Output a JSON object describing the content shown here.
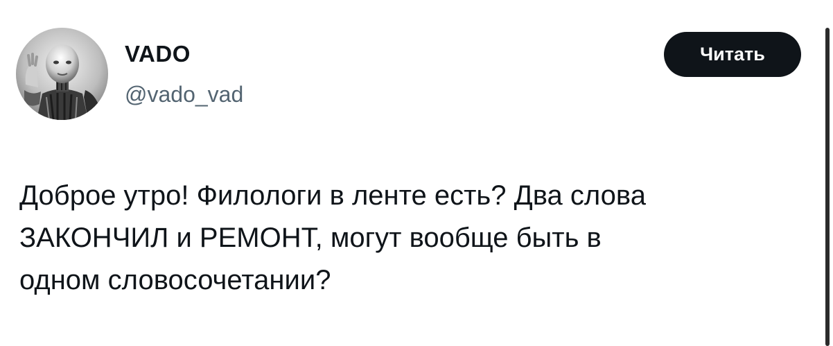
{
  "author": {
    "display_name": "VADO",
    "handle": "@vado_vad",
    "avatar_icon": "robot-avatar-icon"
  },
  "follow_button": {
    "label": "Читать",
    "background": "#0f1419",
    "text_color": "#ffffff"
  },
  "tweet": {
    "lines": [
      "Доброе утро! Филологи в ленте есть? Два слова",
      "ЗАКОНЧИЛ и РЕМОНТ, могут вообще быть в",
      "одном словосочетании?"
    ]
  },
  "colors": {
    "text": "#0f1419",
    "secondary_text": "#536471",
    "background": "#ffffff"
  }
}
